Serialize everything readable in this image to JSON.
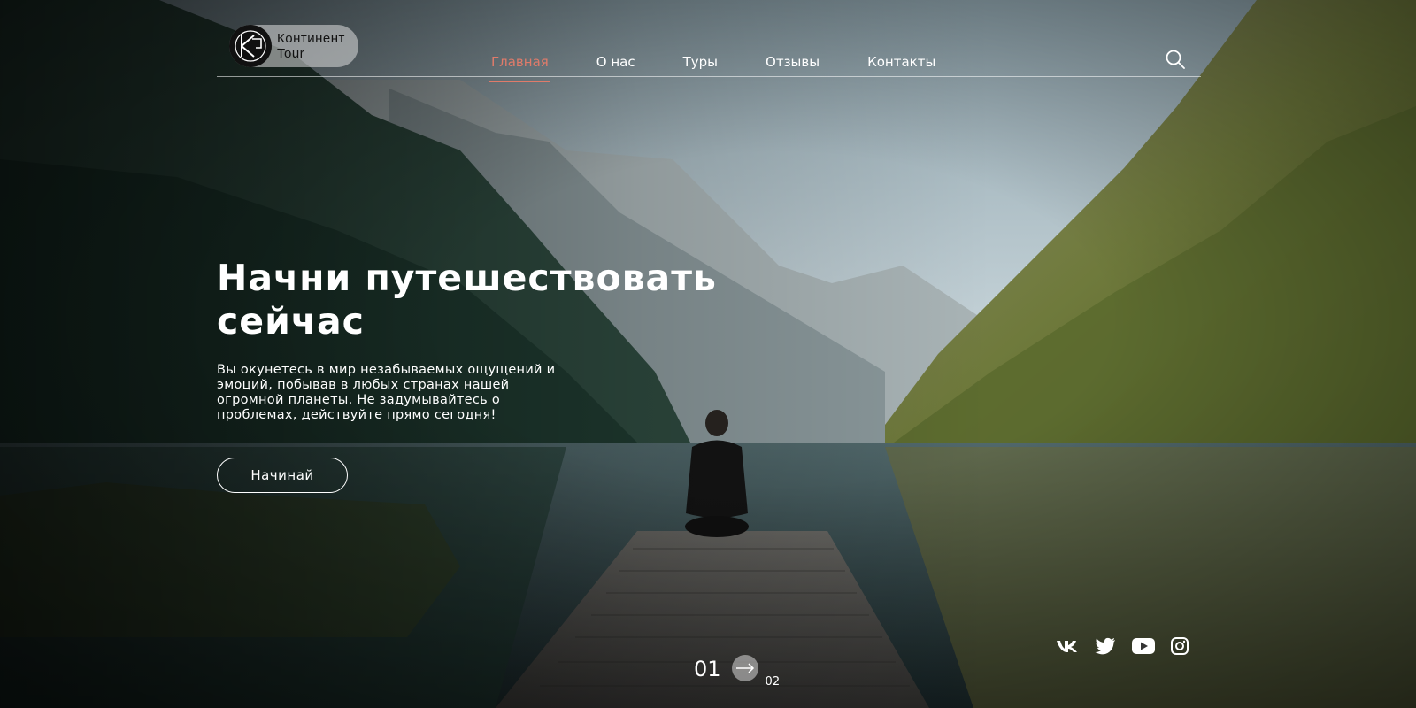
{
  "brand": {
    "line1": "Континент",
    "line2": "Tour",
    "logo_icon": "continent-tour-logo"
  },
  "nav": {
    "items": [
      {
        "label": "Главная",
        "active": true
      },
      {
        "label": "О нас"
      },
      {
        "label": "Туры"
      },
      {
        "label": "Отзывы"
      },
      {
        "label": "Контакты"
      }
    ],
    "search_icon": "search-icon"
  },
  "hero": {
    "title": "Начни путешествовать сейчас",
    "lead": "Вы окунетесь в мир незабываемых ощущений и эмоций, побывав в любых странах нашей огромной планеты. Не задумывайтесь о проблемах, действуйте прямо сегодня!",
    "cta_label": "Начинай"
  },
  "social": [
    "vk-icon",
    "twitter-icon",
    "youtube-icon",
    "instagram-icon"
  ],
  "slider": {
    "current": "01",
    "total": "02",
    "next_icon": "arrow-right-icon"
  },
  "colors": {
    "accent": "#e07b6a",
    "text": "#ffffff"
  }
}
